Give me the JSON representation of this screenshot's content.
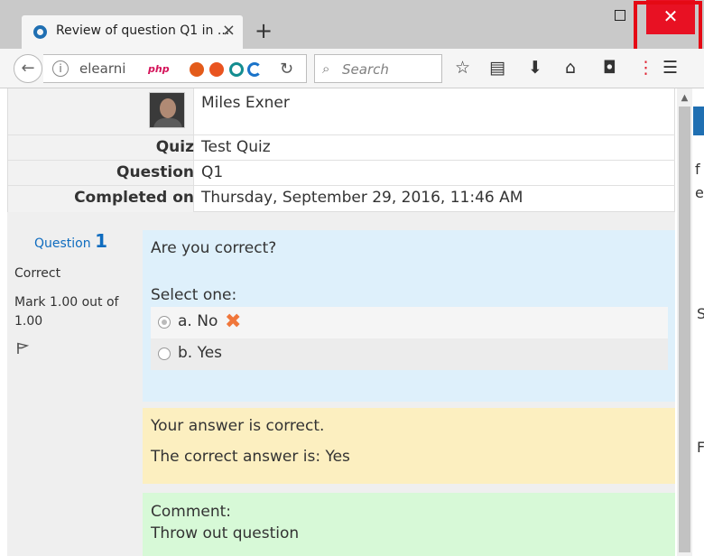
{
  "browser": {
    "tab_title": "Review of question Q1 in ...",
    "new_tab_label": "+",
    "url_text": "elearnir",
    "search_placeholder": "Search",
    "extension_php_label": "php",
    "close_glyph": "✕",
    "accent_close_color": "#e81123"
  },
  "summary": {
    "user_name": "Miles Exner",
    "rows": [
      {
        "label": "Quiz",
        "value": "Test Quiz"
      },
      {
        "label": "Question",
        "value": "Q1"
      },
      {
        "label": "Completed on",
        "value": "Thursday, September 29, 2016, 11:46 AM"
      }
    ]
  },
  "question_info": {
    "label": "Question",
    "number": "1",
    "state": "Correct",
    "grade": "Mark 1.00 out of 1.00"
  },
  "question": {
    "text": "Are you correct?",
    "prompt": "Select one:",
    "answers": [
      {
        "label": "a. No",
        "selected": true,
        "marked_wrong": true
      },
      {
        "label": "b. Yes",
        "selected": false,
        "marked_wrong": false
      }
    ]
  },
  "feedback": {
    "result": "Your answer is correct.",
    "correct_answer": "The correct answer is: Yes",
    "outcome_color": "#fcefc0"
  },
  "comment": {
    "label": "Comment:",
    "text": "Throw out question",
    "comment_color": "#d7f9d7"
  },
  "side_fragments": {
    "f": "f",
    "e": "e",
    "s": "S",
    "F": "F"
  }
}
